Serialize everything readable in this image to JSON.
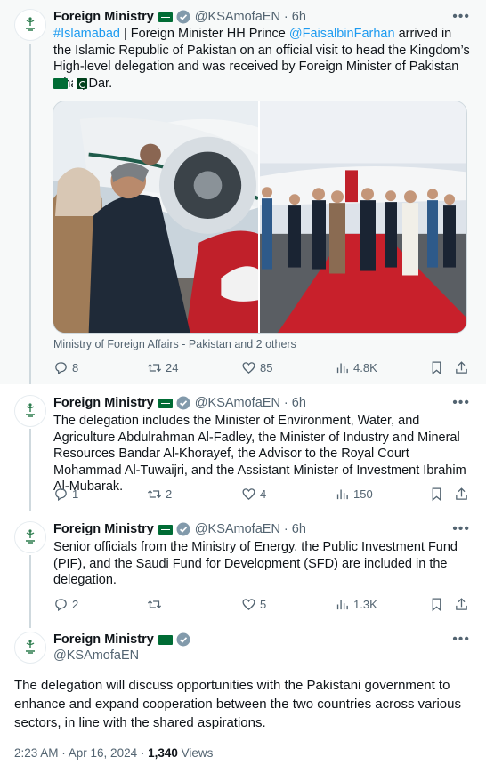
{
  "account": {
    "name": "Foreign Ministry",
    "handle": "@KSAmofaEN"
  },
  "tweets": [
    {
      "time": "6h",
      "hashtag": "#Islamabad",
      "text_a": " | Foreign Minister HH Prince ",
      "mention": "@FaisalbinFarhan",
      "text_b": " arrived in the Islamic Republic of Pakistan on an official visit to head the Kingdom’s High-level delegation and was received by Foreign Minister of Pakistan Ishaq Dar.",
      "media_caption": "Ministry of Foreign Affairs - Pakistan and 2 others",
      "replies": "8",
      "retweets": "24",
      "likes": "85",
      "views": "4.8K"
    },
    {
      "time": "6h",
      "text": "The delegation includes the Minister of Environment, Water, and Agriculture Abdulrahman Al-Fadley, the Minister of Industry and Mineral Resources Bandar Al-Khorayef, the Advisor to the Royal Court Mohammad Al-Tuwaijri, and the Assistant Minister of Investment Ibrahim Al-Mubarak.",
      "replies": "1",
      "retweets": "2",
      "likes": "4",
      "views": "150"
    },
    {
      "time": "6h",
      "text": "Senior officials from the Ministry of Energy, the Public Investment Fund (PIF), and the Saudi Fund for Development (SFD) are included in the delegation.",
      "replies": "2",
      "retweets": "",
      "likes": "5",
      "views": "1.3K"
    }
  ],
  "focused_tweet": {
    "text": "The delegation will discuss opportunities with the Pakistani government to enhance and expand cooperation between the two countries across various sectors, in line with the shared aspirations.",
    "timestamp": "2:23 AM · Apr 16, 2024 · ",
    "views_count": "1,340",
    "views_label": " Views"
  },
  "icons": {
    "reply": "reply-icon",
    "retweet": "retweet-icon",
    "like": "heart-icon",
    "views": "views-chart-icon",
    "bookmark": "bookmark-icon",
    "share": "share-icon",
    "more": "more-icon",
    "verified": "verified-badge-icon"
  },
  "colors": {
    "link": "#1d9bf0",
    "verified": "#829aab",
    "flag_saudi": "#006c35"
  }
}
